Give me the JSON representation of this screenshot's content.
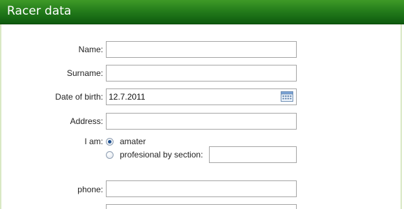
{
  "header": {
    "title": "Racer data"
  },
  "form": {
    "name": {
      "label": "Name:",
      "value": ""
    },
    "surname": {
      "label": "Surname:",
      "value": ""
    },
    "dob": {
      "label": "Date of birth:",
      "value": "12.7.2011"
    },
    "address": {
      "label": "Address:",
      "value": ""
    },
    "iam": {
      "label": "I am:",
      "options": [
        {
          "label": "amater",
          "checked": true
        },
        {
          "label": "profesional by section:",
          "checked": false
        }
      ],
      "section_value": ""
    },
    "phone": {
      "label": "phone:",
      "value": ""
    }
  },
  "colors": {
    "header_green": "#227a1a",
    "panel_border": "#d9e8c4"
  },
  "icons": {
    "calendar": "calendar-icon"
  }
}
